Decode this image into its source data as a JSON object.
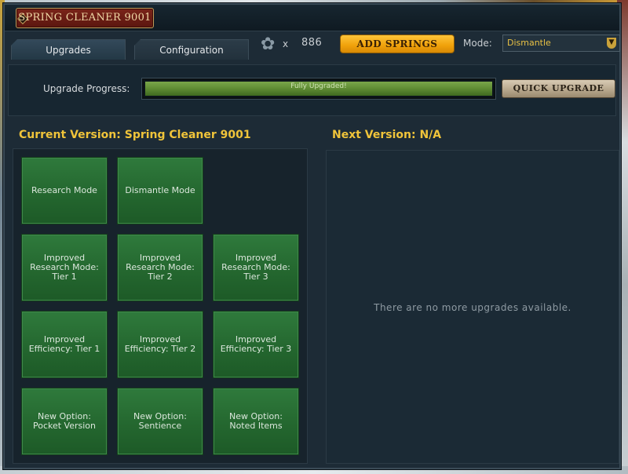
{
  "window": {
    "title": "SPRING CLEANER 9001"
  },
  "tabs": [
    {
      "label": "Upgrades",
      "active": true
    },
    {
      "label": "Configuration",
      "active": false
    }
  ],
  "springs": {
    "icon": "spring-icon",
    "multiplier": "x",
    "count": "886",
    "add_button": "ADD SPRINGS"
  },
  "mode": {
    "label": "Mode:",
    "selected": "Dismantle"
  },
  "progress": {
    "label": "Upgrade Progress:",
    "text": "Fully Upgraded!",
    "fraction": 1.0,
    "quick_upgrade_button": "QUICK UPGRADE"
  },
  "current": {
    "heading": "Current Version: Spring Cleaner 9001",
    "tiles": [
      [
        "Research Mode",
        "Dismantle Mode",
        ""
      ],
      [
        "Improved\nResearch Mode:\nTier 1",
        "Improved\nResearch Mode:\nTier 2",
        "Improved\nResearch Mode:\nTier 3"
      ],
      [
        "Improved\nEfficiency: Tier 1",
        "Improved\nEfficiency: Tier 2",
        "Improved\nEfficiency: Tier 3"
      ],
      [
        "New Option:\nPocket Version",
        "New Option:\nSentience",
        "New Option:\nNoted Items"
      ]
    ]
  },
  "next": {
    "heading": "Next Version: N/A",
    "message": "There are no more upgrades available."
  },
  "colors": {
    "accent_gold": "#f0c43a",
    "tile_green": "#24672f",
    "progress_green": "#5e8b33",
    "add_button_orange": "#f0a10a"
  }
}
